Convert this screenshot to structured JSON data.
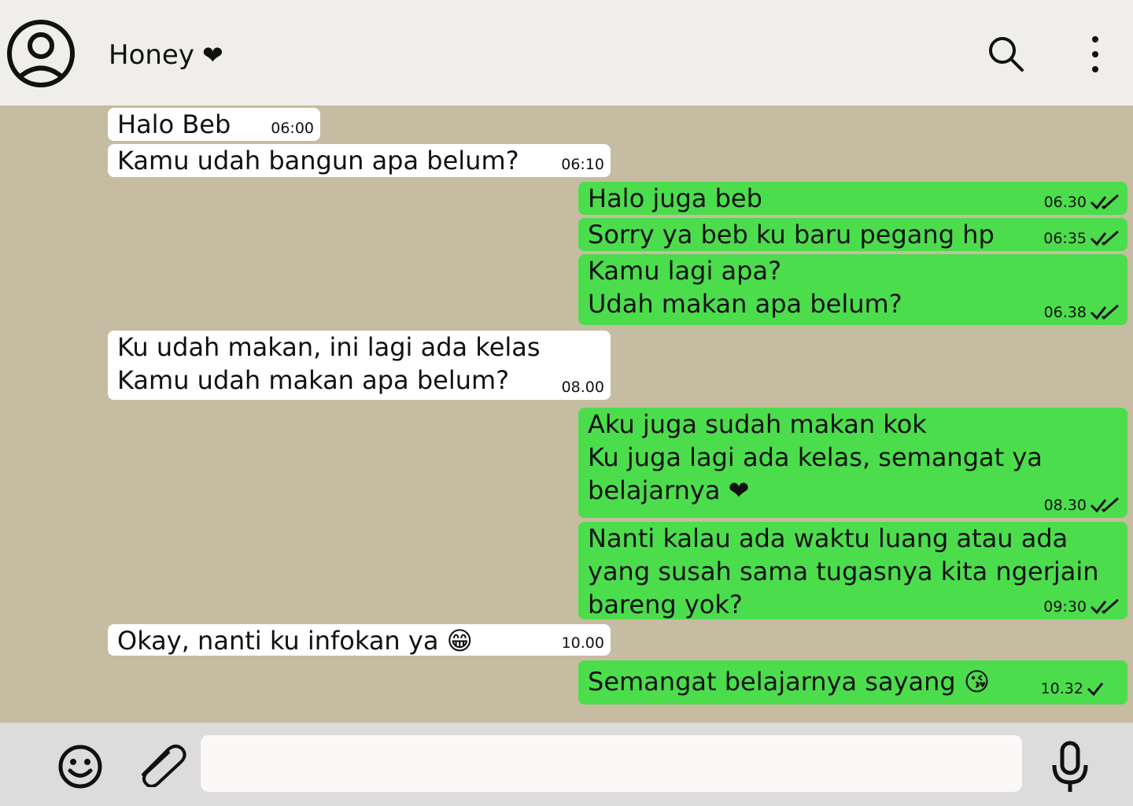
{
  "header": {
    "contact_name": "Honey",
    "contact_heart": "❤"
  },
  "messages": [
    {
      "dir": "in",
      "text": "Halo Beb",
      "time": "06:00"
    },
    {
      "dir": "in",
      "text": "Kamu udah bangun apa belum?",
      "time": "06:10"
    },
    {
      "dir": "out",
      "text": "Halo juga beb",
      "time": "06.30",
      "ticks": 2
    },
    {
      "dir": "out",
      "text": "Sorry ya beb ku baru pegang hp",
      "time": "06:35",
      "ticks": 2
    },
    {
      "dir": "out",
      "text": "Kamu lagi apa?\nUdah makan apa belum?",
      "time": "06.38",
      "ticks": 2
    },
    {
      "dir": "in",
      "text": "Ku udah makan, ini lagi ada kelas\nKamu udah makan apa belum?",
      "time": "08.00"
    },
    {
      "dir": "out",
      "text": "Aku juga sudah makan kok\nKu juga lagi ada kelas, semangat ya\nbelajarnya ❤",
      "time": "08.30",
      "ticks": 2
    },
    {
      "dir": "out",
      "text": "Nanti kalau ada waktu luang atau ada\nyang susah sama tugasnya kita ngerjain\nbareng yok?",
      "time": "09:30",
      "ticks": 2
    },
    {
      "dir": "in",
      "text": "Okay, nanti ku infokan ya 😁",
      "time": "10.00"
    },
    {
      "dir": "out",
      "text": "Semangat belajarnya sayang 😘",
      "time": "10.32",
      "ticks": 1
    }
  ],
  "composer": {
    "input_value": "",
    "placeholder": ""
  },
  "colors": {
    "header_bg": "#efeeea",
    "chat_bg": "#c5bca1",
    "incoming_bubble": "#ffffff",
    "outgoing_bubble": "#4cdd4c",
    "composer_bg": "#dcdcdc"
  },
  "icons": [
    "avatar-icon",
    "search-icon",
    "more-vertical-icon",
    "emoji-icon",
    "attachment-icon",
    "microphone-icon",
    "double-check-icon",
    "single-check-icon"
  ]
}
